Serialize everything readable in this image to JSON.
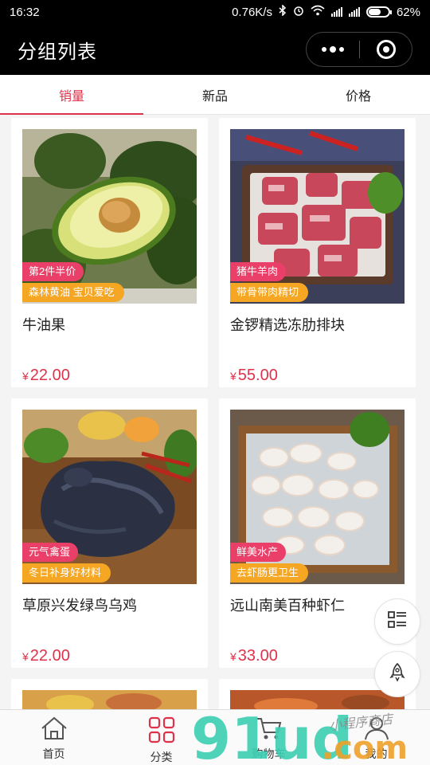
{
  "status_bar": {
    "time": "16:32",
    "speed": "0.76K/s",
    "battery": "62%",
    "battery_level": 0.62
  },
  "nav": {
    "title": "分组列表"
  },
  "tabs": [
    {
      "label": "销量",
      "active": true
    },
    {
      "label": "新品",
      "active": false
    },
    {
      "label": "价格",
      "active": false
    }
  ],
  "products": [
    {
      "name": "牛油果",
      "tag1": "第2件半价",
      "tag2": "森林黄油 宝贝爱吃",
      "currency": "¥",
      "price": "22.00"
    },
    {
      "name": "金锣精选冻肋排块",
      "tag1": "猪牛羊肉",
      "tag2": "带骨带肉精切",
      "currency": "¥",
      "price": "55.00"
    },
    {
      "name": "草原兴发绿鸟乌鸡",
      "tag1": "元气禽蛋",
      "tag2": "冬日补身好材料",
      "currency": "¥",
      "price": "22.00"
    },
    {
      "name": "远山南美百种虾仁",
      "tag1": "鲜美水产",
      "tag2": "去虾肠更卫生",
      "currency": "¥",
      "price": "33.00"
    }
  ],
  "tabbar": [
    {
      "label": "首页",
      "icon": "home-icon"
    },
    {
      "label": "分类",
      "icon": "category-icon",
      "active": true
    },
    {
      "label": "购物车",
      "icon": "cart-icon"
    },
    {
      "label": "我的",
      "icon": "user-icon"
    }
  ],
  "watermark": {
    "brand": "91ud",
    "suffix": ".com",
    "tagline": "小程序商店"
  },
  "colors": {
    "accent": "#e0314a",
    "badge_pink": "#ea3f68",
    "badge_orange": "#f5a623"
  }
}
